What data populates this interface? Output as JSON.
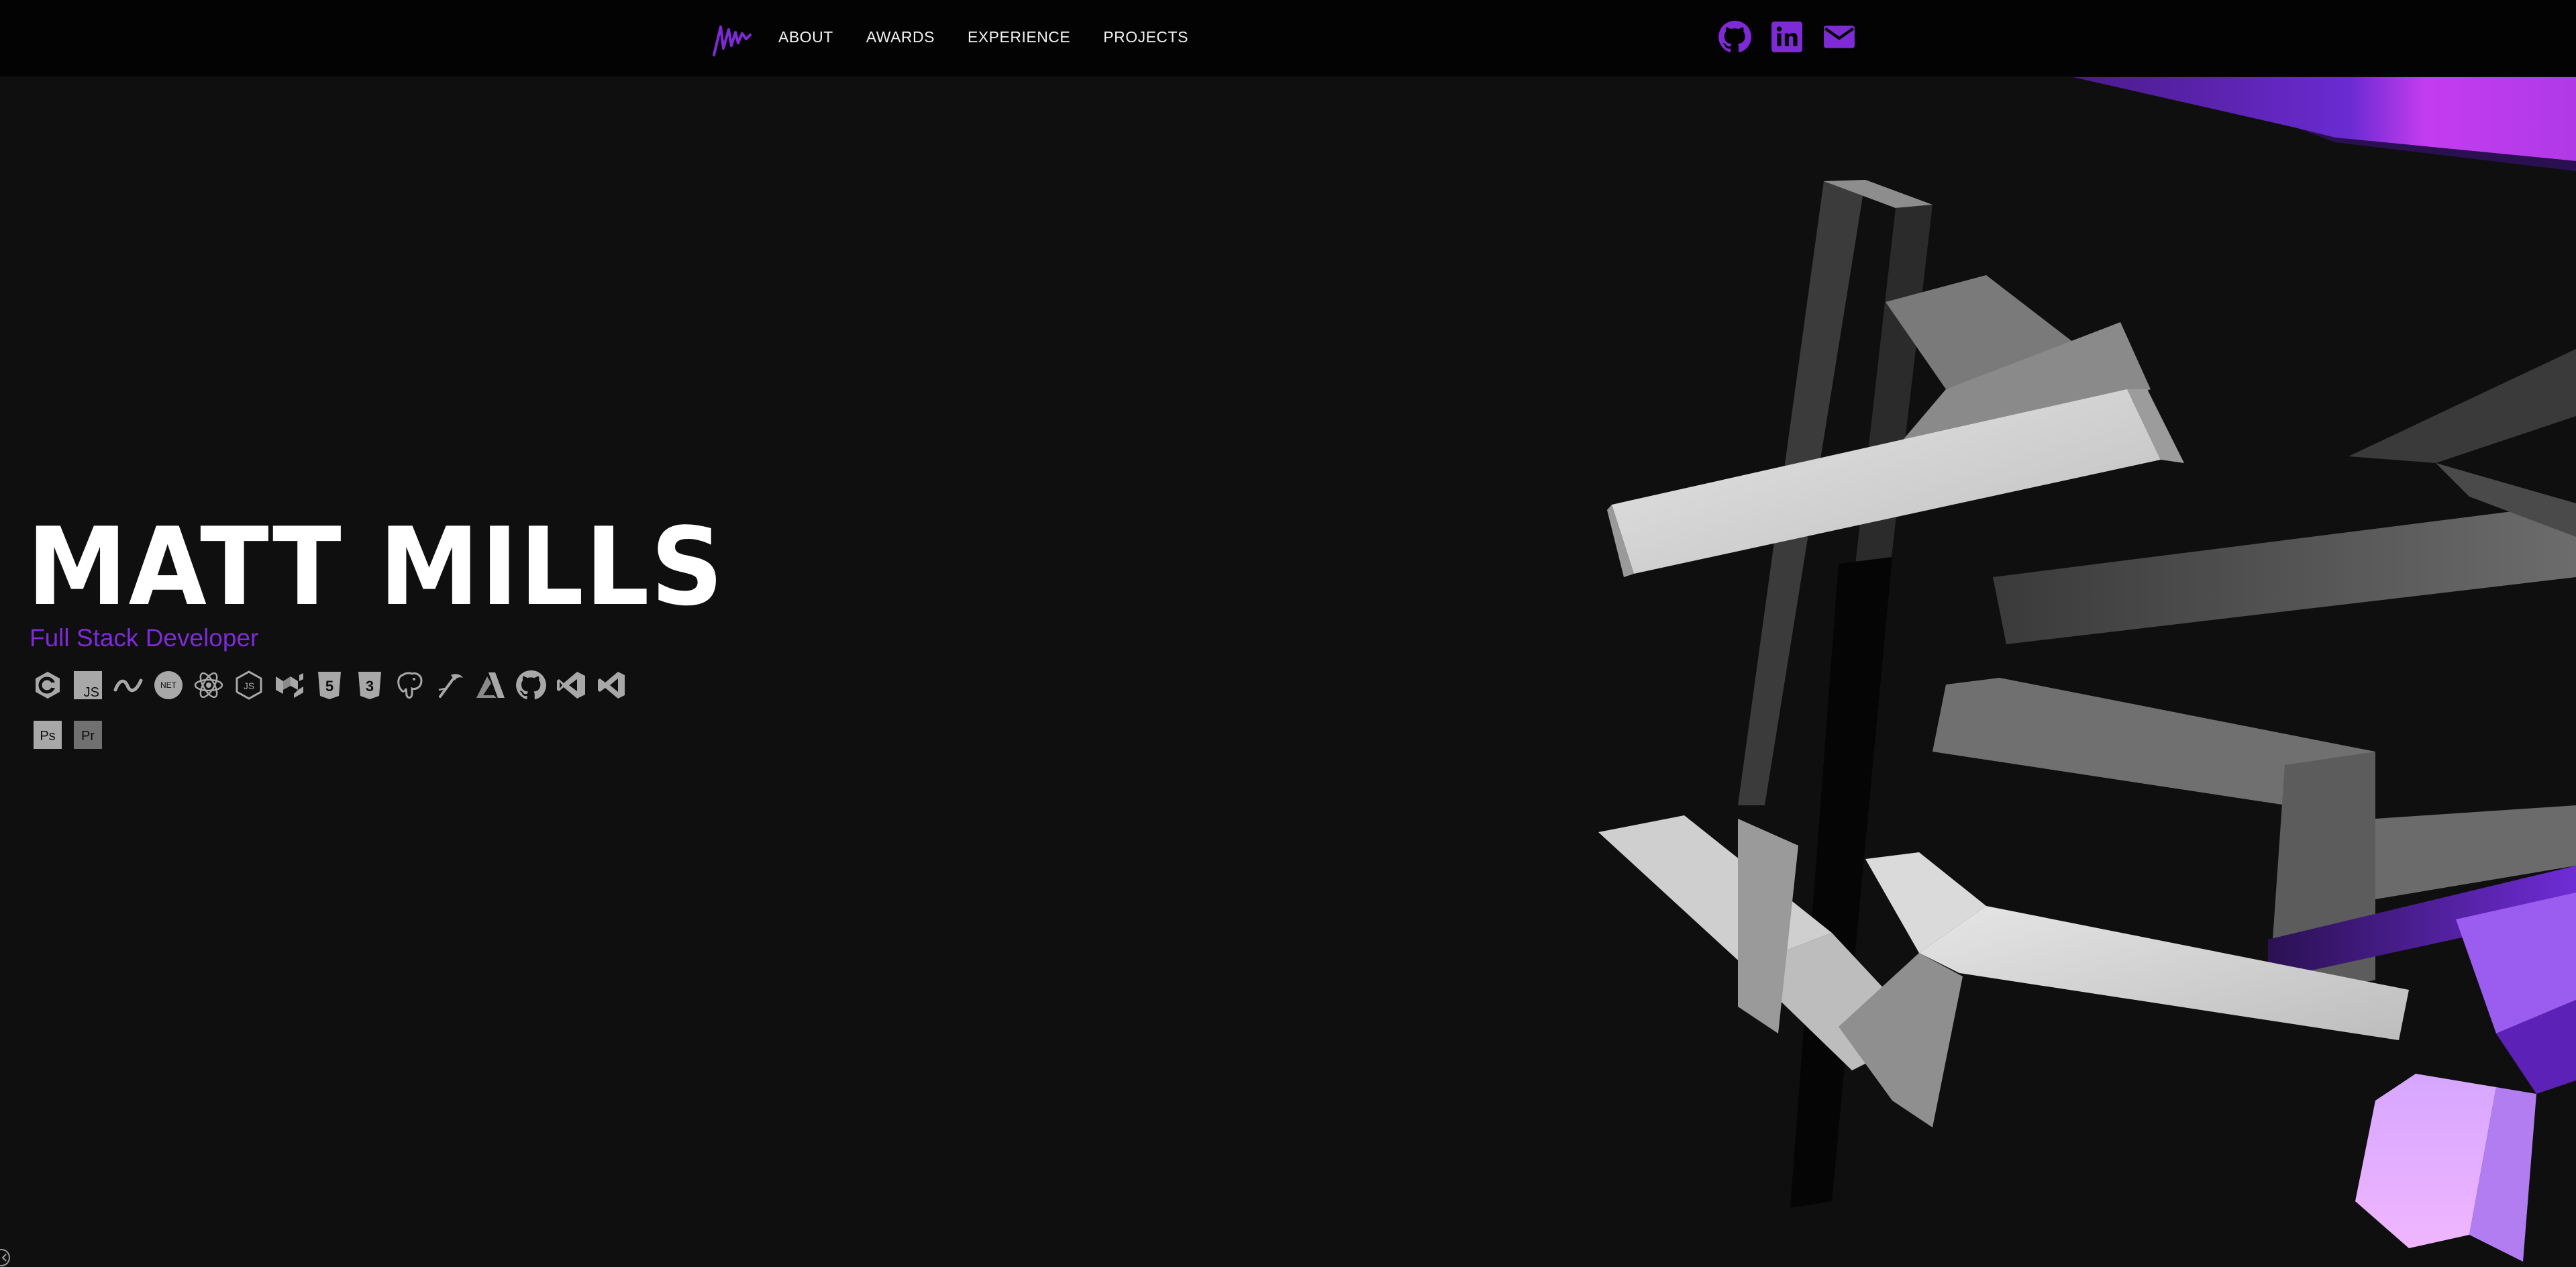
{
  "nav": {
    "logo_icon": "mm-signature-logo-icon",
    "items": [
      {
        "label": "ABOUT"
      },
      {
        "label": "AWARDS"
      },
      {
        "label": "EXPERIENCE"
      },
      {
        "label": "PROJECTS"
      }
    ]
  },
  "socials": [
    {
      "icon": "github-icon"
    },
    {
      "icon": "linkedin-icon"
    },
    {
      "icon": "mail-icon"
    }
  ],
  "hero": {
    "name": "MATT MILLS",
    "subtitle": "Full Stack Developer"
  },
  "skills": [
    {
      "icon": "csharp-icon",
      "text": "C"
    },
    {
      "icon": "javascript-icon",
      "text": "JS"
    },
    {
      "icon": "nuxt-swirl-icon",
      "text": ""
    },
    {
      "icon": "dotnet-icon",
      "text": "NET"
    },
    {
      "icon": "react-icon",
      "text": ""
    },
    {
      "icon": "nodejs-icon",
      "text": "JS"
    },
    {
      "icon": "material-ui-icon",
      "text": ""
    },
    {
      "icon": "html5-icon",
      "text": "5"
    },
    {
      "icon": "css3-icon",
      "text": "3"
    },
    {
      "icon": "postgresql-icon",
      "text": ""
    },
    {
      "icon": "wand-icon",
      "text": ""
    },
    {
      "icon": "azure-icon",
      "text": ""
    },
    {
      "icon": "github-icon",
      "text": ""
    },
    {
      "icon": "visual-studio-icon",
      "text": ""
    },
    {
      "icon": "vscode-icon",
      "text": ""
    },
    {
      "icon": "photoshop-icon",
      "text": "Ps"
    },
    {
      "icon": "premiere-icon",
      "text": "Pr"
    }
  ],
  "colors": {
    "accent": "#7e2ad6",
    "background": "#0f0f0f",
    "topbar": "#030303",
    "icon_gray": "#a8a8a8"
  }
}
